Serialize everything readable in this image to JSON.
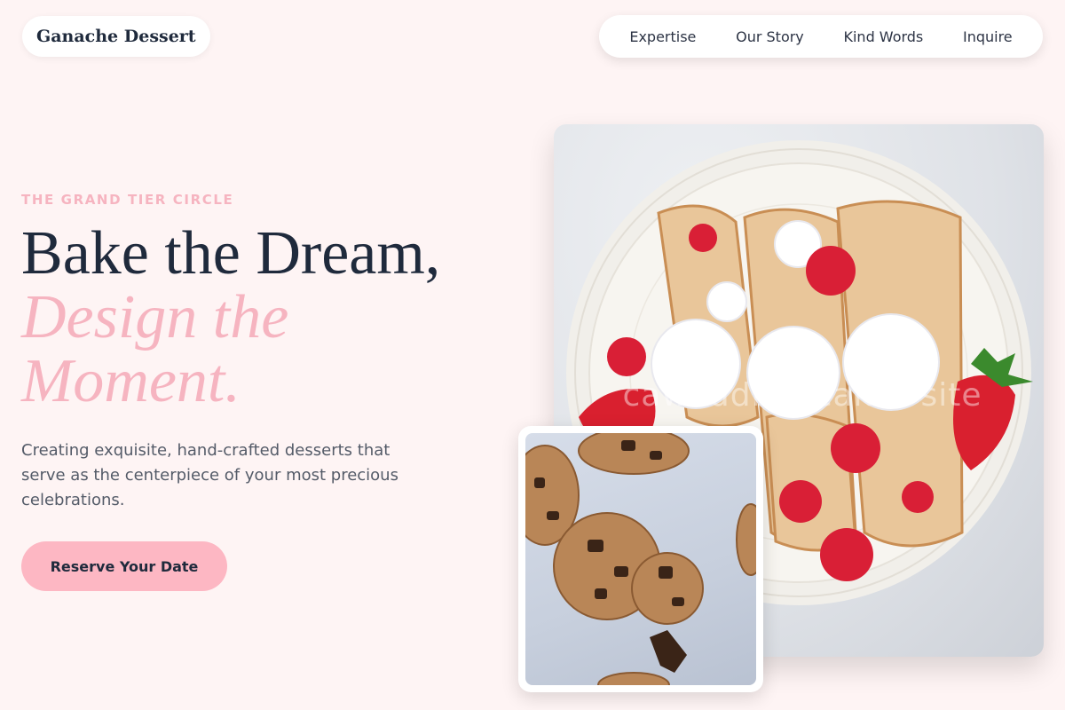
{
  "brand": {
    "name": "Ganache Dessert"
  },
  "nav": {
    "items": [
      "Expertise",
      "Our Story",
      "Kind Words",
      "Inquire"
    ]
  },
  "hero": {
    "eyebrow": "THE GRAND TIER CIRCLE",
    "headline_line1": "Bake the Dream,",
    "headline_accent": "Design the Moment.",
    "description": "Creating exquisite, hand-crafted desserts that serve as the centerpiece of your most precious celebrations.",
    "cta_label": "Reserve Your Date",
    "watermark": "cawedding cakes site"
  },
  "images": {
    "main_icon": "crepes-plate-photo",
    "inset_icon": "cookies-photo"
  },
  "colors": {
    "background": "#fef4f4",
    "accent_pink": "#f6b4c0",
    "button_pink": "#fdb7c3",
    "text_dark": "#1f2a3c"
  }
}
